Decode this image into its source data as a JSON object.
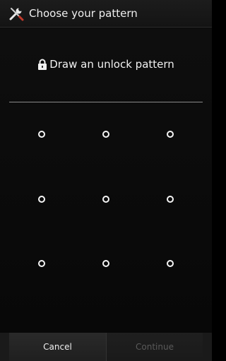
{
  "title_bar": {
    "title": "Choose your pattern",
    "icon": "tools-icon"
  },
  "header": {
    "icon": "lock-icon",
    "text": "Draw an unlock pattern"
  },
  "pattern": {
    "rows": 3,
    "cols": 3,
    "dot_color": "#f5f5f5"
  },
  "buttons": {
    "cancel_label": "Cancel",
    "continue_label": "Continue",
    "continue_enabled": false
  },
  "colors": {
    "background": "#0a0a0a",
    "divider": "#8a8a8a",
    "disabled_text": "#5a5a5a"
  }
}
